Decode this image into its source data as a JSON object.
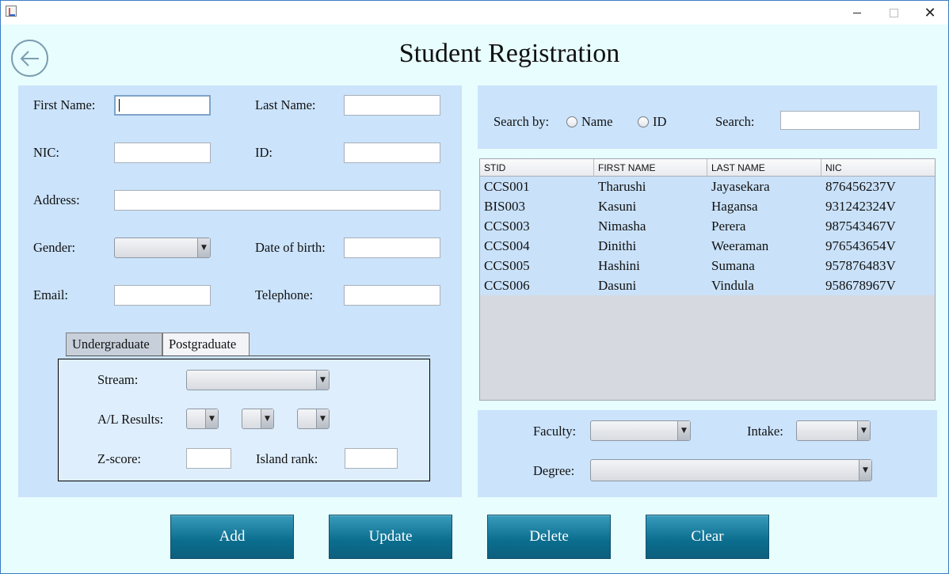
{
  "window": {
    "close_glyph": "✕"
  },
  "header": {
    "title": "Student Registration",
    "back_icon": "arrow-left-icon"
  },
  "form": {
    "first_name_label": "First Name:",
    "last_name_label": "Last Name:",
    "nic_label": "NIC:",
    "id_label": "ID:",
    "address_label": "Address:",
    "gender_label": "Gender:",
    "dob_label": "Date of birth:",
    "email_label": "Email:",
    "telephone_label": "Telephone:",
    "first_name_value": "",
    "last_name_value": "",
    "nic_value": "",
    "id_value": "",
    "address_value": "",
    "gender_value": "",
    "dob_value": "",
    "email_value": "",
    "telephone_value": ""
  },
  "tabs": {
    "items": [
      {
        "label": "Undergraduate",
        "active": true
      },
      {
        "label": "Postgraduate",
        "active": false
      }
    ],
    "stream_label": "Stream:",
    "al_results_label": "A/L Results:",
    "zscore_label": "Z-score:",
    "island_rank_label": "Island rank:"
  },
  "search": {
    "search_by_label": "Search by:",
    "option_name": "Name",
    "option_id": "ID",
    "search_label": "Search:",
    "search_value": ""
  },
  "table": {
    "columns": [
      "STID",
      "FIRST NAME",
      "LAST NAME",
      "NIC"
    ],
    "rows": [
      [
        "CCS001",
        "Tharushi",
        "Jayasekara",
        "876456237V"
      ],
      [
        "BIS003",
        "Kasuni",
        "Hagansa",
        "931242324V"
      ],
      [
        "CCS003",
        "Nimasha",
        "Perera",
        "987543467V"
      ],
      [
        "CCS004",
        "Dinithi",
        "Weeraman",
        "976543654V"
      ],
      [
        "CCS005",
        "Hashini",
        "Sumana",
        "957876483V"
      ],
      [
        "CCS006",
        "Dasuni",
        "Vindula",
        "958678967V"
      ]
    ]
  },
  "academic": {
    "faculty_label": "Faculty:",
    "intake_label": "Intake:",
    "degree_label": "Degree:"
  },
  "actions": {
    "add": "Add",
    "update": "Update",
    "delete": "Delete",
    "clear": "Clear"
  },
  "combo_arrow": "▼"
}
